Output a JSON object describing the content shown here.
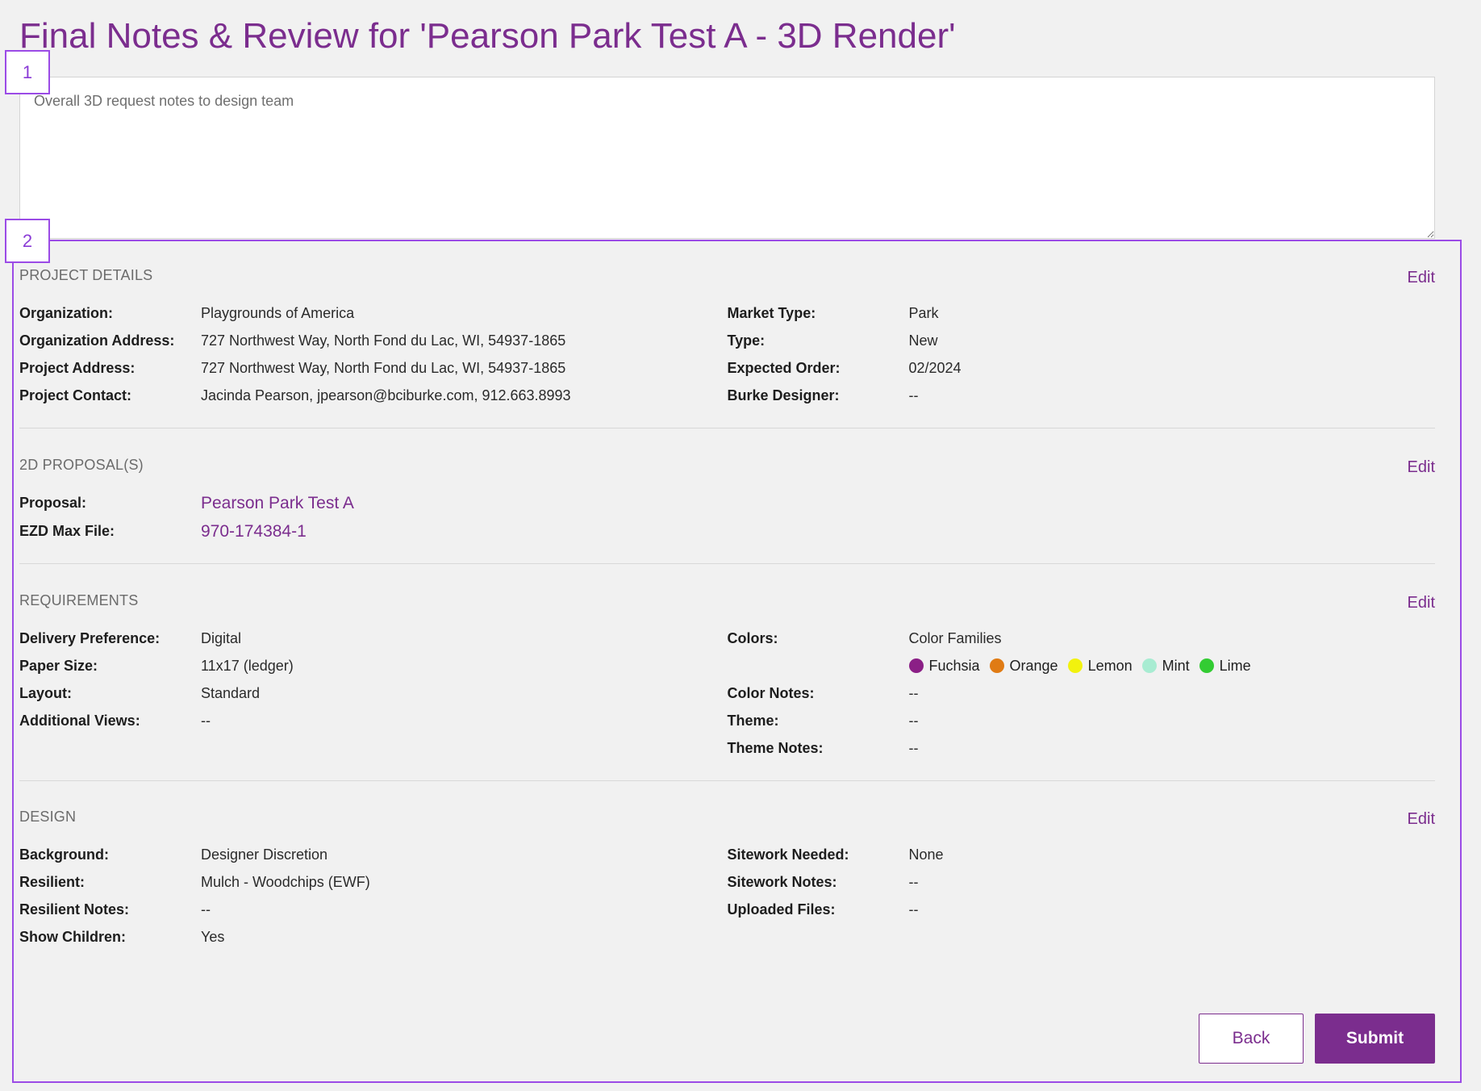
{
  "page": {
    "title": "Final Notes & Review for 'Pearson Park Test A - 3D Render'",
    "notes_placeholder": "Overall 3D request notes to design team",
    "notes_value": ""
  },
  "annotations": {
    "box1": "1",
    "box2": "2"
  },
  "project_details": {
    "title": "PROJECT DETAILS",
    "edit": "Edit",
    "left": [
      {
        "label": "Organization:",
        "value": "Playgrounds of America"
      },
      {
        "label": "Organization Address:",
        "value": "727 Northwest Way, North Fond du Lac, WI, 54937-1865"
      },
      {
        "label": "Project Address:",
        "value": "727 Northwest Way, North Fond du Lac, WI, 54937-1865"
      },
      {
        "label": "Project Contact:",
        "value": "Jacinda Pearson, jpearson@bciburke.com, 912.663.8993"
      }
    ],
    "right": [
      {
        "label": "Market Type:",
        "value": "Park"
      },
      {
        "label": "Type:",
        "value": "New"
      },
      {
        "label": "Expected Order:",
        "value": "02/2024"
      },
      {
        "label": "Burke Designer:",
        "value": "--"
      }
    ]
  },
  "proposals": {
    "title": "2D PROPOSAL(S)",
    "edit": "Edit",
    "rows": [
      {
        "label": "Proposal:",
        "value": "Pearson Park Test A"
      },
      {
        "label": "EZD Max File:",
        "value": "970-174384-1"
      }
    ]
  },
  "requirements": {
    "title": "REQUIREMENTS",
    "edit": "Edit",
    "left": [
      {
        "label": "Delivery Preference:",
        "value": "Digital"
      },
      {
        "label": "Paper Size:",
        "value": "11x17 (ledger)"
      },
      {
        "label": "Layout:",
        "value": "Standard"
      },
      {
        "label": "Additional Views:",
        "value": "--"
      }
    ],
    "colors_label": "Colors:",
    "colors_value": "Color Families",
    "swatches": [
      {
        "name": "Fuchsia",
        "color": "#8b1f86"
      },
      {
        "name": "Orange",
        "color": "#e07b14"
      },
      {
        "name": "Lemon",
        "color": "#f2f20e"
      },
      {
        "name": "Mint",
        "color": "#a8ecd2"
      },
      {
        "name": "Lime",
        "color": "#33cc33"
      }
    ],
    "right": [
      {
        "label": "Color Notes:",
        "value": "--"
      },
      {
        "label": "Theme:",
        "value": "--"
      },
      {
        "label": "Theme Notes:",
        "value": "--"
      }
    ]
  },
  "design": {
    "title": "DESIGN",
    "edit": "Edit",
    "left": [
      {
        "label": "Background:",
        "value": "Designer Discretion"
      },
      {
        "label": "Resilient:",
        "value": "Mulch - Woodchips (EWF)"
      },
      {
        "label": "Resilient Notes:",
        "value": "--"
      },
      {
        "label": "Show Children:",
        "value": "Yes"
      }
    ],
    "right": [
      {
        "label": "Sitework Needed:",
        "value": "None"
      },
      {
        "label": "Sitework Notes:",
        "value": "--"
      },
      {
        "label": "Uploaded Files:",
        "value": "--"
      }
    ]
  },
  "actions": {
    "back": "Back",
    "submit": "Submit"
  },
  "colors": {
    "accent": "#7b2d8e",
    "annotation": "#9b4be6",
    "background": "#f1f1f1"
  }
}
